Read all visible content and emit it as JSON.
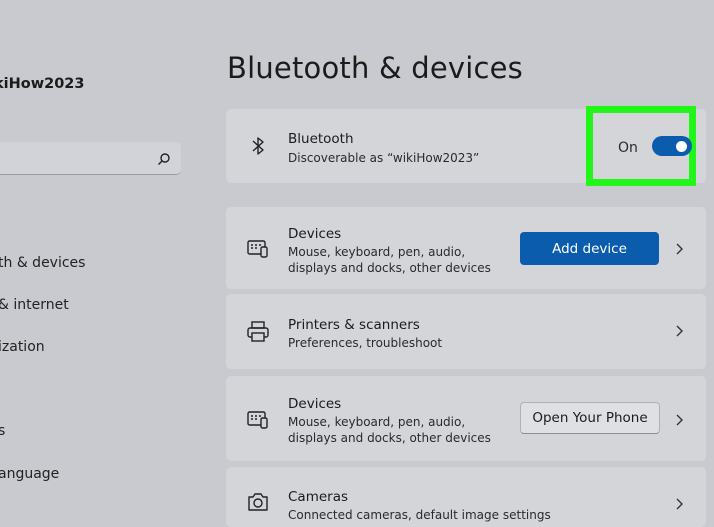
{
  "sidebar": {
    "user_name": "kiHow2023",
    "search_placeholder": "",
    "nav_items": [
      {
        "label": "th & devices"
      },
      {
        "label": "& internet"
      },
      {
        "label": "ization"
      },
      {
        "label": "s"
      },
      {
        "label": "anguage"
      }
    ]
  },
  "page": {
    "title": "Bluetooth & devices"
  },
  "bluetooth_card": {
    "title": "Bluetooth",
    "description": "Discoverable as “wikiHow2023”",
    "toggle_label": "On",
    "toggle_state": true,
    "icon": "bluetooth-icon"
  },
  "cards": [
    {
      "title": "Devices",
      "description_lines": [
        "Mouse, keyboard, pen, audio,",
        "displays and docks, other devices"
      ],
      "button": "Add device",
      "icon": "devices-icon"
    },
    {
      "title": "Printers & scanners",
      "description_lines": [
        "Preferences, troubleshoot"
      ],
      "icon": "printer-icon"
    },
    {
      "title": "Devices",
      "description_lines": [
        "Mouse, keyboard, pen, audio,",
        "displays and docks, other devices"
      ],
      "button": "Open Your Phone",
      "icon": "devices-icon"
    },
    {
      "title": "Cameras",
      "description_lines": [
        "Connected cameras, default image settings"
      ],
      "icon": "camera-icon"
    }
  ],
  "colors": {
    "accent": "#0b5cad",
    "highlight": "#22f51a",
    "background": "#c9cacf",
    "card": "#d4d5d9"
  }
}
